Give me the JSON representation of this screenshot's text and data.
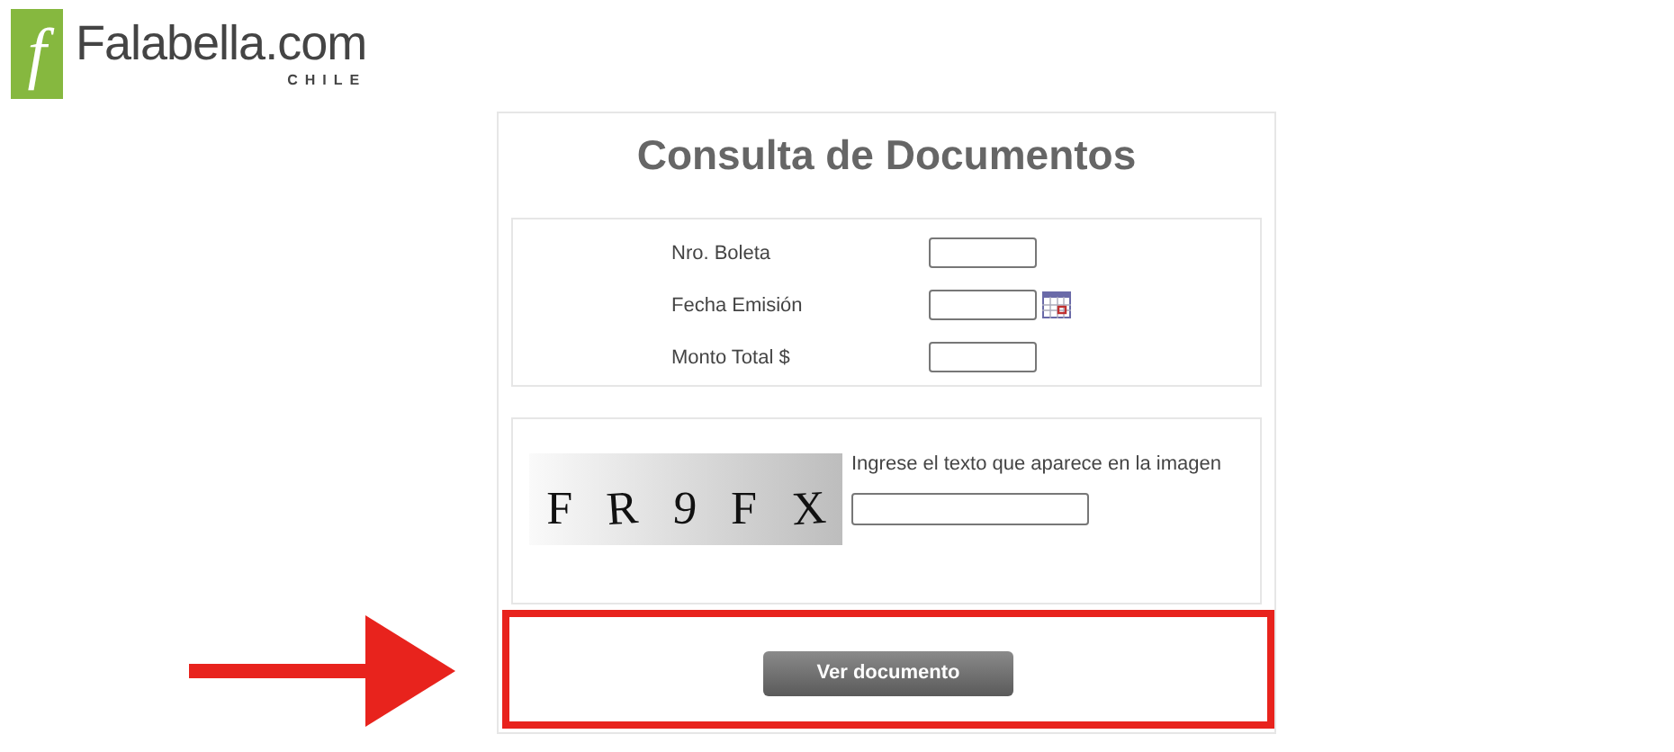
{
  "logo": {
    "name": "Falabella.com",
    "country": "CHILE",
    "glyph": "f"
  },
  "title": "Consulta de Documentos",
  "fields": [
    {
      "label": "Nro. Boleta",
      "kind": "text"
    },
    {
      "label": "Fecha Emisión",
      "kind": "date"
    },
    {
      "label": "Monto Total $",
      "kind": "text"
    }
  ],
  "captcha": {
    "characters": [
      "F",
      "R",
      "9",
      "F",
      "X"
    ],
    "prompt": "Ingrese el texto que aparece en la imagen"
  },
  "button": "Ver documento"
}
